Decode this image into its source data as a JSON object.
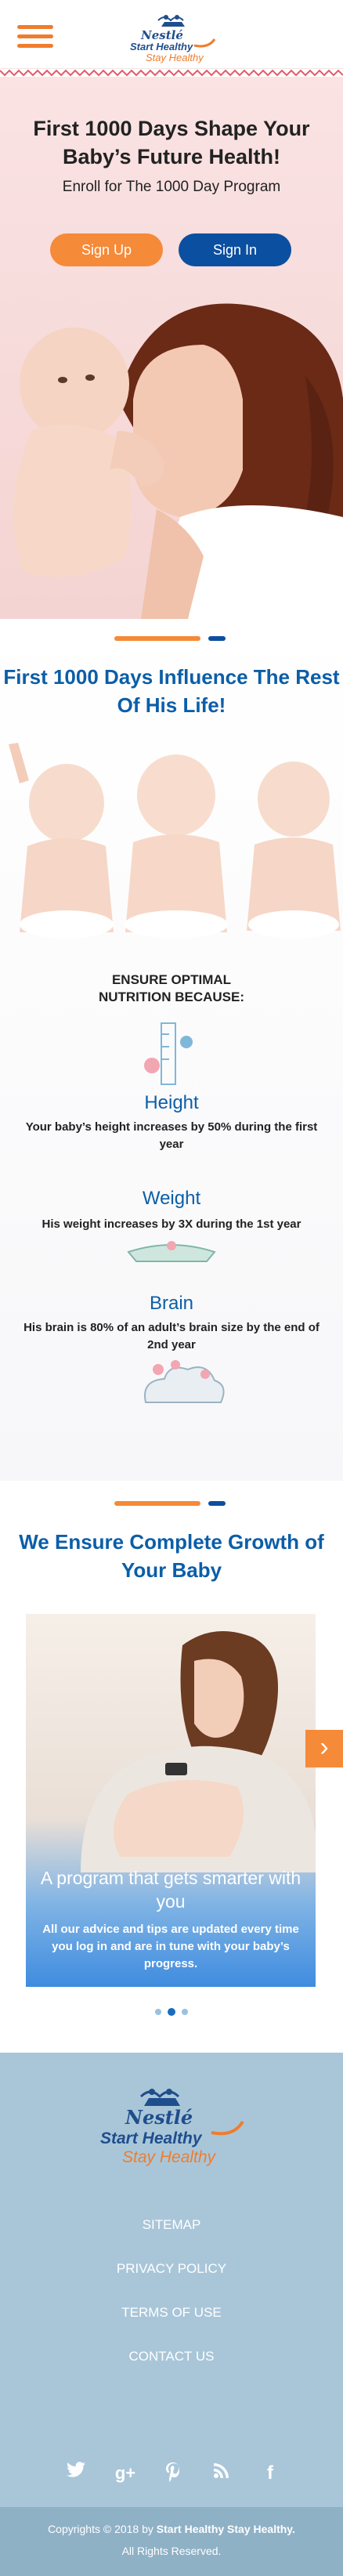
{
  "header": {
    "logo": {
      "brand": "Nestlé",
      "line1": "Start Healthy",
      "line2": "Stay Healthy"
    }
  },
  "hero": {
    "title": "First 1000 Days Shape Your Baby’s Future Health!",
    "subtitle": "Enroll for The 1000 Day Program",
    "signup_label": "Sign Up",
    "signin_label": "Sign In"
  },
  "influence": {
    "title": "First 1000 Days Influence The Rest Of His Life!",
    "ensure_label": "ENSURE OPTIMAL NUTRITION BECAUSE:",
    "features": [
      {
        "title": "Height",
        "text": "Your baby’s height increases by 50% during the first year"
      },
      {
        "title": "Weight",
        "text": "His weight increases by 3X during the 1st year"
      },
      {
        "title": "Brain",
        "text": "His brain is 80% of an adult’s brain size by the end of 2nd year"
      }
    ]
  },
  "growth": {
    "title": "We Ensure Complete Growth of Your Baby",
    "slide": {
      "title": "A program that gets smarter with you",
      "text": "All our advice and tips are updated every time you log in and are in tune with your baby’s progress."
    },
    "next_arrow": "›"
  },
  "footer": {
    "logo": {
      "brand": "Nestlé",
      "line1": "Start Healthy",
      "line2": "Stay Healthy"
    },
    "links": [
      "SITEMAP",
      "PRIVACY POLICY",
      "TERMS OF USE",
      "CONTACT US"
    ],
    "social_icons": [
      "twitter-icon",
      "google-plus-icon",
      "pinterest-icon",
      "rss-icon",
      "facebook-icon"
    ]
  },
  "copyright": {
    "prefix": "Copyrights © 2018 by ",
    "brand": "Start Healthy Stay Healthy.",
    "rights": "All Rights Reserved."
  },
  "colors": {
    "orange": "#f58a38",
    "blue": "#0b4fa0",
    "heading_blue": "#0b5ea8",
    "footer_bg": "#a9c6d9"
  }
}
